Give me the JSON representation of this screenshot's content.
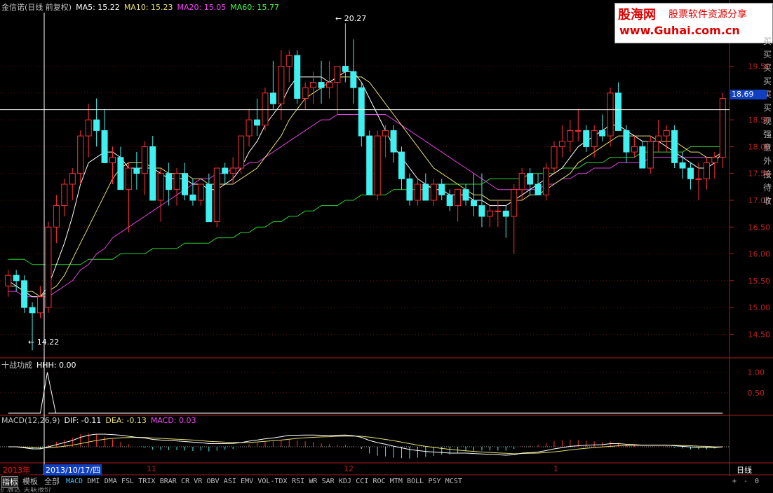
{
  "header": {
    "main": {
      "name": "金信诺(日线 前复权)",
      "items": [
        {
          "label": "MA5: 15.22",
          "color": "#ffffff"
        },
        {
          "label": "MA10: 15.23",
          "color": "#e8e070"
        },
        {
          "label": "MA20: 15.05",
          "color": "#ff40ff"
        },
        {
          "label": "MA60: 15.77",
          "color": "#40ff40"
        }
      ]
    },
    "ind": {
      "name": "十战功成",
      "items": [
        {
          "label": "HHH: 0.00",
          "color": "#ffffff"
        }
      ]
    },
    "macd": {
      "name": "MACD(12,26,9)",
      "items": [
        {
          "label": "DIF: -0.11",
          "color": "#ffffff"
        },
        {
          "label": "DEA: -0.13",
          "color": "#e8e070"
        },
        {
          "label": "MACD: 0.03",
          "color": "#ff40ff"
        }
      ]
    }
  },
  "logo": {
    "line1": "股海网",
    "line1b": "股票软件资源分享",
    "line2": "www.Guhai.com.cn"
  },
  "annotations": {
    "high": "20.27",
    "low": "14.22",
    "crosshair_price": "18.69"
  },
  "x_axis": {
    "year": "2013年",
    "cursor_date": "2013/10/17/四",
    "month_11": "11",
    "month_12": "12",
    "month_1": "1",
    "period": "日线"
  },
  "side_text": "买买买买买买现强意外接待收",
  "tabs": {
    "cn": [
      "指标",
      "模板",
      "全部"
    ],
    "items": [
      "MACD",
      "DMI",
      "DMA",
      "FSL",
      "TRIX",
      "BRAR",
      "CR",
      "VR",
      "OBV",
      "ASI",
      "EMV",
      "VOL-TDX",
      "RSI",
      "WR",
      "SAR",
      "KDJ",
      "CCI",
      "ROC",
      "MTM",
      "BOLL",
      "PSY",
      "MCST"
    ],
    "right": [
      "+",
      "-",
      "0"
    ]
  },
  "footer": "扩展区  关联报价",
  "chart_data": {
    "type": "candlestick",
    "price_ticks": [
      "19.50",
      "19.00",
      "18.50",
      "18.00",
      "17.50",
      "17.00",
      "16.50",
      "16.00",
      "15.50",
      "15.00",
      "14.50"
    ],
    "ind_ticks": [
      "1.00",
      "0.50"
    ],
    "candles": [
      [
        15.4,
        15.7,
        15.2,
        15.6
      ],
      [
        15.6,
        15.7,
        15.3,
        15.5
      ],
      [
        15.5,
        15.6,
        14.9,
        15.0
      ],
      [
        15.0,
        15.1,
        14.2,
        14.9
      ],
      [
        14.9,
        15.4,
        14.8,
        15.2
      ],
      [
        15.0,
        16.6,
        14.9,
        16.5
      ],
      [
        16.5,
        17.1,
        16.2,
        16.9
      ],
      [
        16.9,
        17.4,
        16.7,
        17.3
      ],
      [
        17.3,
        17.6,
        17.0,
        17.5
      ],
      [
        17.5,
        18.3,
        17.3,
        18.2
      ],
      [
        18.2,
        18.8,
        17.8,
        18.5
      ],
      [
        18.5,
        18.9,
        18.0,
        18.3
      ],
      [
        18.3,
        18.7,
        17.8,
        17.7
      ],
      [
        17.7,
        18.0,
        17.3,
        17.8
      ],
      [
        17.8,
        18.0,
        17.2,
        17.2
      ],
      [
        17.2,
        17.7,
        16.4,
        17.6
      ],
      [
        17.6,
        17.9,
        17.2,
        17.5
      ],
      [
        17.5,
        18.1,
        17.1,
        18.0
      ],
      [
        18.0,
        18.2,
        17.0,
        17.0
      ],
      [
        17.0,
        17.6,
        16.6,
        17.5
      ],
      [
        17.5,
        17.7,
        16.9,
        17.2
      ],
      [
        17.2,
        17.6,
        16.9,
        17.5
      ],
      [
        17.5,
        17.7,
        17.0,
        17.1
      ],
      [
        17.1,
        17.4,
        16.9,
        17.0
      ],
      [
        17.0,
        17.3,
        16.9,
        17.3
      ],
      [
        17.3,
        17.5,
        16.8,
        16.6
      ],
      [
        16.6,
        17.6,
        16.5,
        17.6
      ],
      [
        17.6,
        17.7,
        17.3,
        17.5
      ],
      [
        17.5,
        17.8,
        17.3,
        17.6
      ],
      [
        17.6,
        18.2,
        17.5,
        18.2
      ],
      [
        18.2,
        18.7,
        18.0,
        18.5
      ],
      [
        18.5,
        18.9,
        18.2,
        18.4
      ],
      [
        18.4,
        19.1,
        18.3,
        19.0
      ],
      [
        19.0,
        19.6,
        18.7,
        18.8
      ],
      [
        18.8,
        19.8,
        18.5,
        19.5
      ],
      [
        19.5,
        19.8,
        19.2,
        19.7
      ],
      [
        19.7,
        19.8,
        18.8,
        18.9
      ],
      [
        18.9,
        19.2,
        18.7,
        19.1
      ],
      [
        19.1,
        19.4,
        18.8,
        19.2
      ],
      [
        19.2,
        19.6,
        18.8,
        19.1
      ],
      [
        19.1,
        19.6,
        18.9,
        19.2
      ],
      [
        19.2,
        19.5,
        18.6,
        19.5
      ],
      [
        19.5,
        20.3,
        19.2,
        19.4
      ],
      [
        19.4,
        20.0,
        18.8,
        19.1
      ],
      [
        19.1,
        19.2,
        18.0,
        18.2
      ],
      [
        18.2,
        18.3,
        17.1,
        17.1
      ],
      [
        17.1,
        18.3,
        17.0,
        18.2
      ],
      [
        18.2,
        18.4,
        17.8,
        18.3
      ],
      [
        18.3,
        18.4,
        17.7,
        17.9
      ],
      [
        17.9,
        18.0,
        17.2,
        17.4
      ],
      [
        17.4,
        17.5,
        16.9,
        17.0
      ],
      [
        17.0,
        17.4,
        16.9,
        17.3
      ],
      [
        17.3,
        17.5,
        17.0,
        17.0
      ],
      [
        17.0,
        17.4,
        16.9,
        17.3
      ],
      [
        17.3,
        17.4,
        17.0,
        17.1
      ],
      [
        17.1,
        17.2,
        16.8,
        16.9
      ],
      [
        16.9,
        17.2,
        16.6,
        17.2
      ],
      [
        17.2,
        17.3,
        16.9,
        17.0
      ],
      [
        17.0,
        17.5,
        16.7,
        16.9
      ],
      [
        16.9,
        17.5,
        16.5,
        16.7
      ],
      [
        16.7,
        16.9,
        16.5,
        16.8
      ],
      [
        16.8,
        17.0,
        16.5,
        16.8
      ],
      [
        16.8,
        16.9,
        16.3,
        16.7
      ],
      [
        16.7,
        17.3,
        16.0,
        17.2
      ],
      [
        17.2,
        17.6,
        17.0,
        17.5
      ],
      [
        17.5,
        17.6,
        17.1,
        17.3
      ],
      [
        17.3,
        17.5,
        17.1,
        17.1
      ],
      [
        17.1,
        17.7,
        17.0,
        17.6
      ],
      [
        17.6,
        18.1,
        17.5,
        18.0
      ],
      [
        18.0,
        18.4,
        17.8,
        18.1
      ],
      [
        18.1,
        18.5,
        17.9,
        18.3
      ],
      [
        18.3,
        18.7,
        18.1,
        18.3
      ],
      [
        18.3,
        18.4,
        17.9,
        18.0
      ],
      [
        18.0,
        18.4,
        17.8,
        18.3
      ],
      [
        18.3,
        18.6,
        18.1,
        18.2
      ],
      [
        18.2,
        19.1,
        18.0,
        19.0
      ],
      [
        19.0,
        19.2,
        18.4,
        18.3
      ],
      [
        18.3,
        18.4,
        17.7,
        17.9
      ],
      [
        17.9,
        18.2,
        17.8,
        18.0
      ],
      [
        18.0,
        18.1,
        17.7,
        17.6
      ],
      [
        17.6,
        18.2,
        17.5,
        18.1
      ],
      [
        18.1,
        18.5,
        17.9,
        18.2
      ],
      [
        18.2,
        18.4,
        17.9,
        18.3
      ],
      [
        18.3,
        18.4,
        17.6,
        17.7
      ],
      [
        17.7,
        17.9,
        17.4,
        17.6
      ],
      [
        17.6,
        17.7,
        17.2,
        17.4
      ],
      [
        17.4,
        17.7,
        17.0,
        17.4
      ],
      [
        17.4,
        17.8,
        17.2,
        17.7
      ],
      [
        17.7,
        17.9,
        17.4,
        17.8
      ],
      [
        17.8,
        19.0,
        17.6,
        18.9
      ]
    ],
    "ma5": [
      15.5,
      15.4,
      15.3,
      15.2,
      15.2,
      15.4,
      15.8,
      16.2,
      16.7,
      17.3,
      17.7,
      17.8,
      17.9,
      17.9,
      17.8,
      17.6,
      17.6,
      17.6,
      17.6,
      17.5,
      17.4,
      17.4,
      17.4,
      17.3,
      17.3,
      17.2,
      17.2,
      17.3,
      17.4,
      17.6,
      17.9,
      18.1,
      18.4,
      18.6,
      18.8,
      19.1,
      19.3,
      19.3,
      19.3,
      19.3,
      19.2,
      19.3,
      19.4,
      19.4,
      19.2,
      18.9,
      18.6,
      18.3,
      18.0,
      17.8,
      17.6,
      17.4,
      17.3,
      17.2,
      17.2,
      17.1,
      17.1,
      17.1,
      17.0,
      17.0,
      16.9,
      16.9,
      16.9,
      17.0,
      17.1,
      17.2,
      17.3,
      17.4,
      17.5,
      17.6,
      17.8,
      18.0,
      18.1,
      18.2,
      18.3,
      18.4,
      18.4,
      18.3,
      18.2,
      18.1,
      18.1,
      18.1,
      18.0,
      17.9,
      17.8,
      17.7,
      17.6,
      17.6,
      17.7,
      17.9
    ],
    "ma10": [
      15.4,
      15.4,
      15.3,
      15.3,
      15.2,
      15.3,
      15.4,
      15.6,
      15.9,
      16.2,
      16.5,
      16.8,
      17.1,
      17.4,
      17.6,
      17.7,
      17.7,
      17.7,
      17.6,
      17.6,
      17.5,
      17.5,
      17.5,
      17.4,
      17.4,
      17.3,
      17.3,
      17.3,
      17.3,
      17.4,
      17.5,
      17.6,
      17.8,
      18.0,
      18.2,
      18.5,
      18.7,
      18.9,
      19.0,
      19.1,
      19.2,
      19.3,
      19.3,
      19.3,
      19.3,
      19.2,
      19.0,
      18.8,
      18.6,
      18.4,
      18.2,
      18.0,
      17.8,
      17.6,
      17.5,
      17.4,
      17.3,
      17.2,
      17.1,
      17.1,
      17.0,
      17.0,
      17.0,
      17.0,
      17.0,
      17.1,
      17.1,
      17.2,
      17.3,
      17.4,
      17.5,
      17.7,
      17.8,
      17.9,
      18.0,
      18.1,
      18.2,
      18.2,
      18.2,
      18.2,
      18.2,
      18.1,
      18.1,
      18.1,
      18.0,
      17.9,
      17.9,
      17.8,
      17.8,
      17.9
    ],
    "ma20": [
      15.3,
      15.3,
      15.2,
      15.2,
      15.2,
      15.2,
      15.3,
      15.4,
      15.5,
      15.7,
      15.8,
      16.0,
      16.1,
      16.3,
      16.4,
      16.5,
      16.6,
      16.7,
      16.8,
      16.9,
      17.0,
      17.1,
      17.2,
      17.3,
      17.4,
      17.4,
      17.5,
      17.5,
      17.6,
      17.6,
      17.7,
      17.7,
      17.8,
      17.9,
      18.0,
      18.1,
      18.2,
      18.3,
      18.4,
      18.5,
      18.5,
      18.6,
      18.6,
      18.6,
      18.6,
      18.6,
      18.6,
      18.6,
      18.5,
      18.4,
      18.3,
      18.2,
      18.1,
      18.0,
      17.9,
      17.8,
      17.7,
      17.6,
      17.5,
      17.4,
      17.3,
      17.2,
      17.2,
      17.2,
      17.2,
      17.2,
      17.2,
      17.3,
      17.3,
      17.4,
      17.4,
      17.5,
      17.5,
      17.6,
      17.6,
      17.6,
      17.7,
      17.7,
      17.7,
      17.7,
      17.8,
      17.8,
      17.8,
      17.8,
      17.8,
      17.8,
      17.8,
      17.8,
      17.8,
      17.9
    ],
    "ma60": [
      15.9,
      15.9,
      15.9,
      15.8,
      15.8,
      15.8,
      15.8,
      15.8,
      15.8,
      15.8,
      15.9,
      15.9,
      15.9,
      15.9,
      16.0,
      16.0,
      16.0,
      16.0,
      16.1,
      16.1,
      16.1,
      16.1,
      16.2,
      16.2,
      16.2,
      16.2,
      16.3,
      16.3,
      16.3,
      16.4,
      16.4,
      16.5,
      16.5,
      16.6,
      16.6,
      16.7,
      16.7,
      16.8,
      16.8,
      16.9,
      16.9,
      16.9,
      17.0,
      17.0,
      17.1,
      17.1,
      17.1,
      17.1,
      17.2,
      17.2,
      17.2,
      17.2,
      17.2,
      17.3,
      17.3,
      17.3,
      17.3,
      17.3,
      17.3,
      17.3,
      17.4,
      17.4,
      17.4,
      17.4,
      17.4,
      17.5,
      17.5,
      17.5,
      17.5,
      17.6,
      17.6,
      17.6,
      17.7,
      17.7,
      17.7,
      17.8,
      17.8,
      17.8,
      17.8,
      17.9,
      17.9,
      17.9,
      17.9,
      17.9,
      17.9,
      18.0,
      18.0,
      18.0,
      18.0,
      18.0
    ],
    "macd_dif": [
      0.0,
      0.0,
      -0.05,
      -0.1,
      -0.1,
      0.0,
      0.1,
      0.2,
      0.3,
      0.45,
      0.55,
      0.6,
      0.6,
      0.58,
      0.55,
      0.5,
      0.45,
      0.42,
      0.35,
      0.32,
      0.3,
      0.28,
      0.25,
      0.22,
      0.2,
      0.15,
      0.15,
      0.15,
      0.16,
      0.2,
      0.27,
      0.32,
      0.38,
      0.42,
      0.48,
      0.55,
      0.55,
      0.56,
      0.56,
      0.55,
      0.54,
      0.55,
      0.56,
      0.53,
      0.45,
      0.3,
      0.2,
      0.12,
      0.03,
      -0.05,
      -0.13,
      -0.18,
      -0.22,
      -0.25,
      -0.27,
      -0.3,
      -0.3,
      -0.3,
      -0.32,
      -0.34,
      -0.36,
      -0.38,
      -0.4,
      -0.38,
      -0.3,
      -0.28,
      -0.25,
      -0.18,
      -0.1,
      -0.04,
      0.02,
      0.05,
      0.07,
      0.09,
      0.1,
      0.15,
      0.15,
      0.12,
      0.1,
      0.08,
      0.08,
      0.08,
      0.08,
      0.05,
      0.02,
      -0.01,
      -0.03,
      -0.04,
      -0.04,
      0.0
    ],
    "macd_dea": [
      0.0,
      0.0,
      -0.02,
      -0.04,
      -0.06,
      -0.05,
      -0.02,
      0.03,
      0.08,
      0.15,
      0.23,
      0.3,
      0.36,
      0.4,
      0.43,
      0.44,
      0.45,
      0.44,
      0.42,
      0.4,
      0.38,
      0.36,
      0.34,
      0.32,
      0.29,
      0.26,
      0.24,
      0.22,
      0.21,
      0.2,
      0.21,
      0.23,
      0.26,
      0.29,
      0.32,
      0.36,
      0.4,
      0.43,
      0.45,
      0.47,
      0.48,
      0.5,
      0.51,
      0.51,
      0.5,
      0.46,
      0.41,
      0.35,
      0.29,
      0.22,
      0.15,
      0.08,
      0.02,
      -0.03,
      -0.08,
      -0.12,
      -0.16,
      -0.19,
      -0.22,
      -0.25,
      -0.27,
      -0.29,
      -0.31,
      -0.33,
      -0.32,
      -0.31,
      -0.3,
      -0.27,
      -0.24,
      -0.2,
      -0.15,
      -0.11,
      -0.07,
      -0.04,
      -0.01,
      0.02,
      0.05,
      0.06,
      0.07,
      0.07,
      0.07,
      0.07,
      0.07,
      0.07,
      0.06,
      0.05,
      0.03,
      0.02,
      0.0,
      -0.01
    ],
    "hhh": {
      "peak_index": 4,
      "peak": 1.0,
      "range": [
        0,
        1.2
      ]
    }
  }
}
